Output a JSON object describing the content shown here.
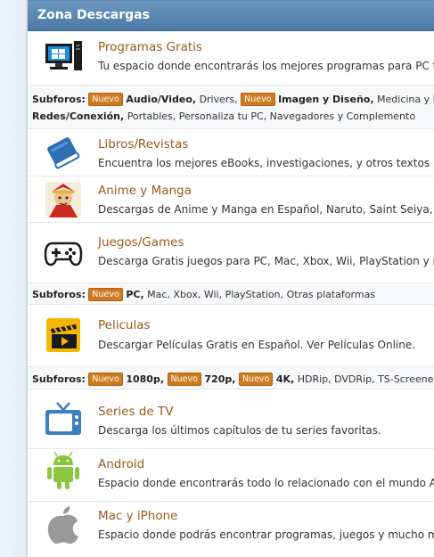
{
  "header": {
    "title": "Zona Descargas"
  },
  "forums": [
    {
      "id": "programas",
      "title": "Programas Gratis",
      "desc": "Tu espacio donde encontrarás los mejores programas para PC to",
      "icon": "computer-icon"
    },
    {
      "id": "libros",
      "title": "Libros/Revistas",
      "desc": "Encuentra los mejores eBooks, investigaciones, y otros textos par",
      "icon": "book-icon"
    },
    {
      "id": "anime",
      "title": "Anime y Manga",
      "desc": "Descargas de Anime y Manga en Español, Naruto, Saint Seiya, De",
      "icon": "anime-icon"
    },
    {
      "id": "juegos",
      "title": "Juegos/Games",
      "desc": "Descarga Gratis juegos para PC, Mac, Xbox, Wii, PlayStation y má",
      "icon": "gamepad-icon"
    },
    {
      "id": "peliculas",
      "title": "Peliculas",
      "desc": "Descargar Películas Gratis en Español. Ver Películas Online.",
      "icon": "clapperboard-icon"
    },
    {
      "id": "series",
      "title": "Series de TV",
      "desc": "Descarga los últimos capítulos de tu series favoritas.",
      "icon": "tv-icon"
    },
    {
      "id": "android",
      "title": "Android",
      "desc": "Espacio donde encontrarás todo lo relacionado con el mundo An",
      "icon": "android-icon"
    },
    {
      "id": "mac",
      "title": "Mac y iPhone",
      "desc": "Espacio donde podrás encontrar programas, juegos y mucho má",
      "icon": "apple-icon"
    }
  ],
  "subforos_label": "Subforos:",
  "badge": "Nuevo",
  "subforos_programas": {
    "line1": {
      "s1": "Audio/Video,",
      "s2": "Drivers,",
      "s3": "Imagen y Diseño,",
      "s4": "Medicina y Keyge"
    },
    "line2": {
      "s1": "Redes/Conexión,",
      "s2": "Portables, Personaliza tu PC, Navegadores y Complemento"
    }
  },
  "subforos_juegos": {
    "s1": "PC,",
    "s2": "Mac, Xbox, Wii, PlayStation, Otras plataformas"
  },
  "subforos_peliculas": {
    "s1": "1080p,",
    "s2": "720p,",
    "s3": "4K,",
    "s4": "HDRip, DVDRip, TS-Screener/DvdS"
  }
}
